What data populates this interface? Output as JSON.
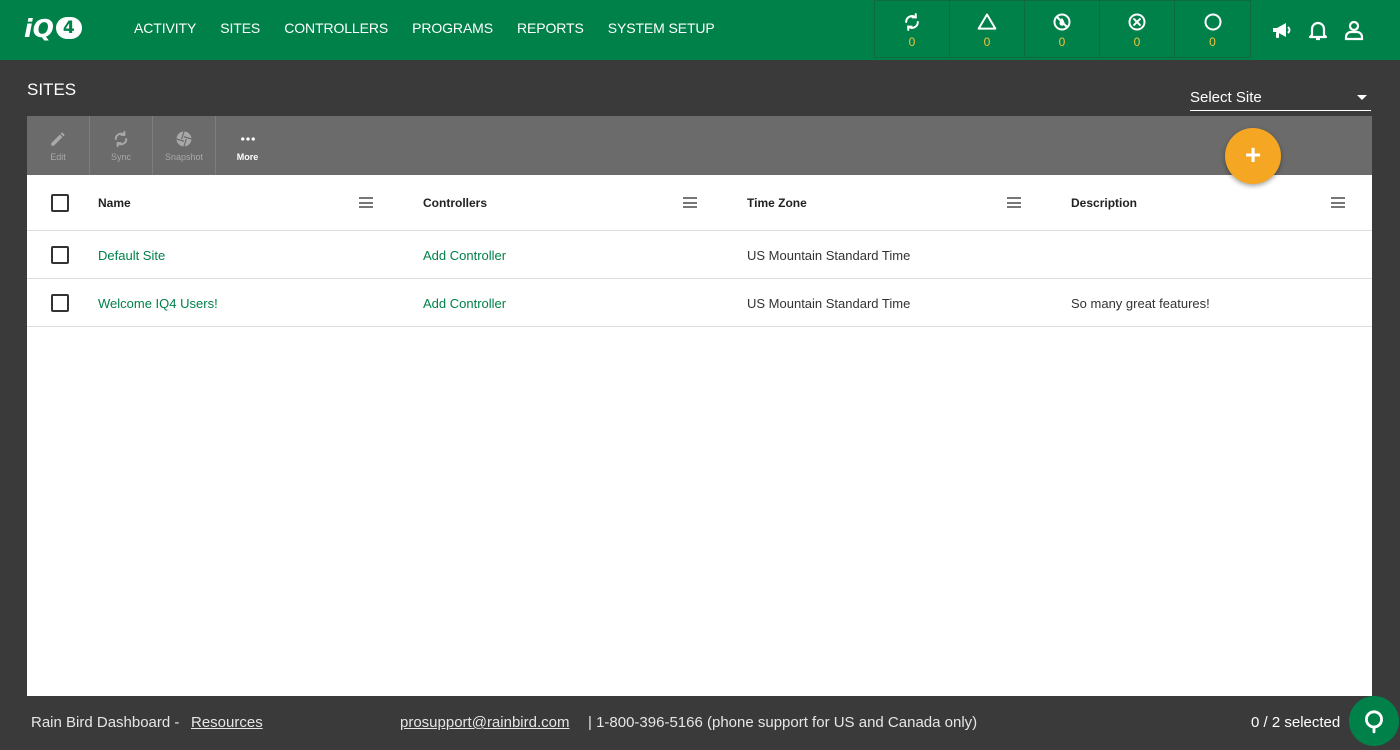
{
  "brand": {
    "logo_left": "iQ",
    "logo_right": "4"
  },
  "nav": {
    "items": [
      "ACTIVITY",
      "SITES",
      "CONTROLLERS",
      "PROGRAMS",
      "REPORTS",
      "SYSTEM SETUP"
    ]
  },
  "status": [
    {
      "icon": "sync-icon",
      "count": "0"
    },
    {
      "icon": "warning-icon",
      "count": "0"
    },
    {
      "icon": "no-water-icon",
      "count": "0"
    },
    {
      "icon": "error-icon",
      "count": "0"
    },
    {
      "icon": "offline-icon",
      "count": "0"
    }
  ],
  "page": {
    "title": "SITES"
  },
  "site_select": {
    "value": "Select Site"
  },
  "toolbar": {
    "edit": "Edit",
    "sync": "Sync",
    "snapshot": "Snapshot",
    "more": "More"
  },
  "table": {
    "headers": {
      "name": "Name",
      "controllers": "Controllers",
      "timezone": "Time Zone",
      "description": "Description"
    },
    "rows": [
      {
        "name": "Default Site",
        "controllers": "Add Controller",
        "timezone": "US Mountain Standard Time",
        "description": ""
      },
      {
        "name": "Welcome IQ4 Users!",
        "controllers": "Add Controller",
        "timezone": "US Mountain Standard Time",
        "description": "So many great features!"
      }
    ]
  },
  "footer": {
    "dashboard": "Rain Bird Dashboard -",
    "resources": "Resources",
    "email": "prosupport@rainbird.com ",
    "phone": "|  1-800-396-5166 (phone support for US and Canada only)",
    "selected": "0 / 2  selected"
  },
  "colors": {
    "brand_green": "#00814a",
    "accent_orange": "#f5a623",
    "status_count": "#f5c23a"
  }
}
